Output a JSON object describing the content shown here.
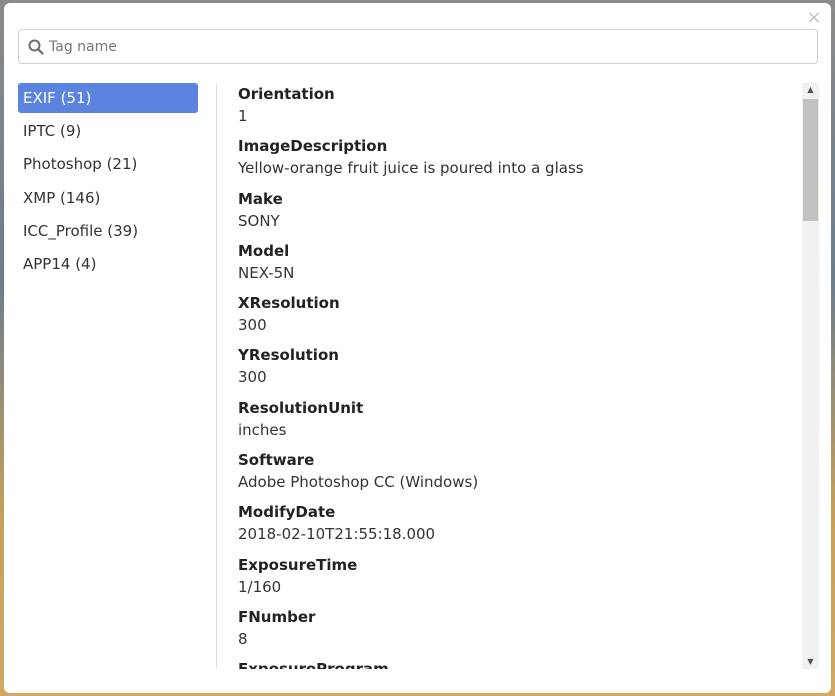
{
  "search": {
    "placeholder": "Tag name",
    "value": ""
  },
  "sidebar": {
    "items": [
      {
        "label": "EXIF (51)",
        "active": true
      },
      {
        "label": "IPTC (9)",
        "active": false
      },
      {
        "label": "Photoshop (21)",
        "active": false
      },
      {
        "label": "XMP (146)",
        "active": false
      },
      {
        "label": "ICC_Profile (39)",
        "active": false
      },
      {
        "label": "APP14 (4)",
        "active": false
      }
    ]
  },
  "tags": [
    {
      "name": "Orientation",
      "value": "1"
    },
    {
      "name": "ImageDescription",
      "value": "Yellow-orange fruit juice is poured into a glass"
    },
    {
      "name": "Make",
      "value": "SONY"
    },
    {
      "name": "Model",
      "value": "NEX-5N"
    },
    {
      "name": "XResolution",
      "value": "300"
    },
    {
      "name": "YResolution",
      "value": "300"
    },
    {
      "name": "ResolutionUnit",
      "value": "inches"
    },
    {
      "name": "Software",
      "value": "Adobe Photoshop CC (Windows)"
    },
    {
      "name": "ModifyDate",
      "value": "2018-02-10T21:55:18.000"
    },
    {
      "name": "ExposureTime",
      "value": "1/160"
    },
    {
      "name": "FNumber",
      "value": "8"
    },
    {
      "name": "ExposureProgram",
      "value": ""
    }
  ],
  "colors": {
    "active": "#5b84e0",
    "border": "#cfcfcf"
  },
  "icons": {
    "close": "close-icon",
    "search": "search-icon"
  }
}
